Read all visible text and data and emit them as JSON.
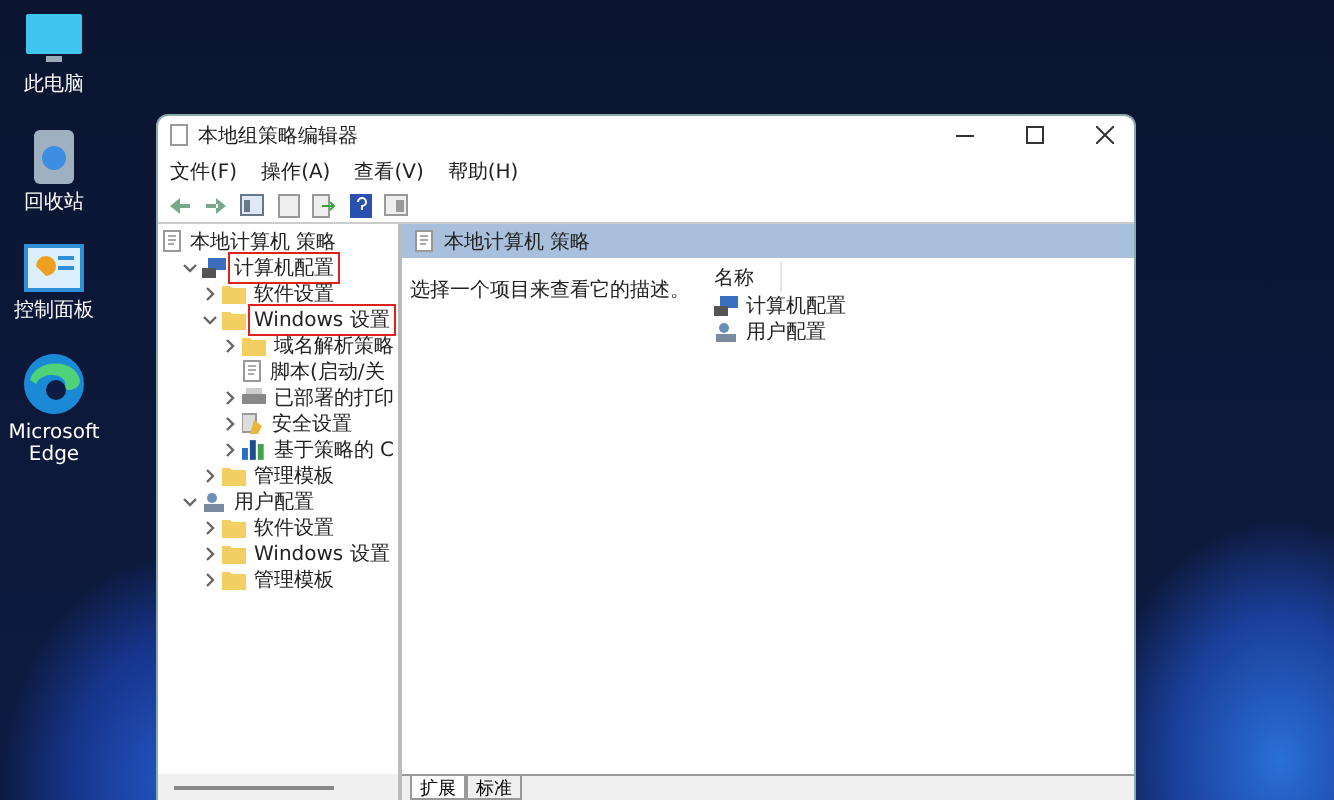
{
  "desktop_icons": [
    {
      "label": "此电脑",
      "kind": "monitor"
    },
    {
      "label": "回收站",
      "kind": "recycle"
    },
    {
      "label": "控制面板",
      "kind": "control"
    },
    {
      "label": "Microsoft Edge",
      "kind": "edge"
    }
  ],
  "window": {
    "title": "本地组策略编辑器"
  },
  "menu": [
    "文件(F)",
    "操作(A)",
    "查看(V)",
    "帮助(H)"
  ],
  "tree": {
    "label": "本地计算机 策略",
    "kind": "policy",
    "children": [
      {
        "label": "计算机配置",
        "kind": "computer",
        "expanded": true,
        "highlighted": true,
        "children": [
          {
            "label": "软件设置",
            "kind": "folder",
            "expanded": false,
            "highlighted": false
          },
          {
            "label": "Windows 设置",
            "kind": "folder",
            "expanded": true,
            "highlighted": true,
            "children": [
              {
                "label": "域名解析策略",
                "kind": "folder",
                "expanded": false,
                "highlighted": false
              },
              {
                "label": "脚本(启动/关",
                "kind": "script",
                "highlighted": false
              },
              {
                "label": "已部署的打印",
                "kind": "printer",
                "expanded": false,
                "highlighted": false
              },
              {
                "label": "安全设置",
                "kind": "security",
                "expanded": false,
                "highlighted": false
              },
              {
                "label": "基于策略的 C",
                "kind": "chart",
                "expanded": false,
                "highlighted": false
              }
            ]
          },
          {
            "label": "管理模板",
            "kind": "folder",
            "expanded": false,
            "highlighted": false
          }
        ]
      },
      {
        "label": "用户配置",
        "kind": "user",
        "expanded": true,
        "highlighted": false,
        "children": [
          {
            "label": "软件设置",
            "kind": "folder",
            "expanded": false,
            "highlighted": false
          },
          {
            "label": "Windows 设置",
            "kind": "folder",
            "expanded": false,
            "highlighted": false
          },
          {
            "label": "管理模板",
            "kind": "folder",
            "expanded": false,
            "highlighted": false
          }
        ]
      }
    ]
  },
  "details": {
    "header": "本地计算机 策略",
    "description": "选择一个项目来查看它的描述。",
    "column": "名称",
    "items": [
      {
        "label": "计算机配置",
        "kind": "computer"
      },
      {
        "label": "用户配置",
        "kind": "user"
      }
    ]
  },
  "bottom_tabs": [
    {
      "label": "扩展",
      "selected": true
    },
    {
      "label": "标准",
      "selected": false
    }
  ]
}
